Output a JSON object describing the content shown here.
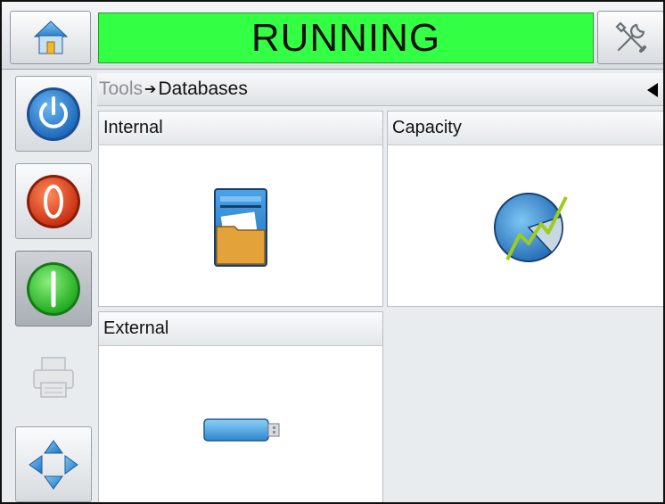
{
  "header": {
    "status_text": "RUNNING",
    "status_color": "#33ff44",
    "home_icon": "home-icon",
    "tools_icon": "tools-icon"
  },
  "rail": {
    "items": [
      {
        "icon": "power-icon",
        "color": "#2a7fd4"
      },
      {
        "icon": "stop-icon",
        "color": "#e8401f"
      },
      {
        "icon": "start-icon",
        "color": "#2fd02f"
      },
      {
        "icon": "printer-icon",
        "disabled": true
      },
      {
        "icon": "navigation-arrows-icon"
      }
    ]
  },
  "breadcrumb": {
    "parent": "Tools",
    "separator": "➔",
    "current": "Databases",
    "back_icon": "back-arrow-icon"
  },
  "tiles": [
    {
      "label": "Internal",
      "icon": "internal-database-icon"
    },
    {
      "label": "Capacity",
      "icon": "capacity-chart-icon"
    },
    {
      "label": "External",
      "icon": "usb-drive-icon"
    }
  ]
}
